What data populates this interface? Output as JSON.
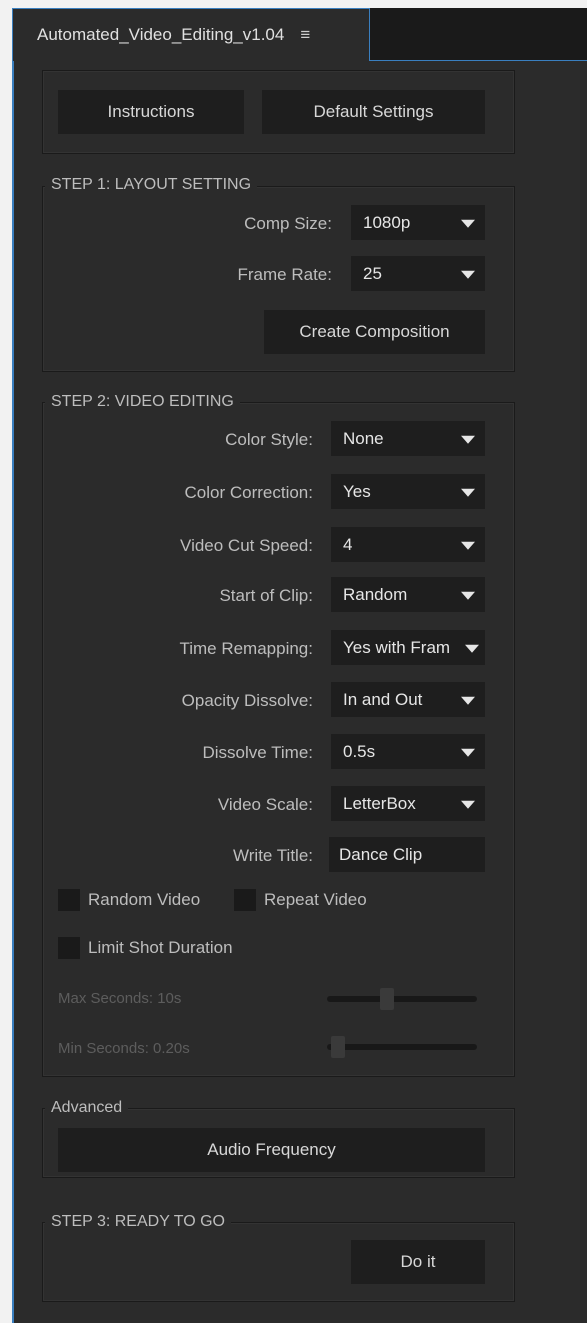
{
  "panel": {
    "title": "Automated_Video_Editing_v1.04",
    "menu_icon": "≡"
  },
  "top_buttons": {
    "instructions": "Instructions",
    "default_settings": "Default Settings"
  },
  "step1": {
    "label": "STEP 1: LAYOUT SETTING",
    "comp_size_label": "Comp Size:",
    "comp_size_value": "1080p",
    "frame_rate_label": "Frame Rate:",
    "frame_rate_value": "25",
    "create_button": "Create Composition"
  },
  "step2": {
    "label": "STEP 2: VIDEO EDITING",
    "rows": [
      {
        "label": "Color Style:",
        "value": "None"
      },
      {
        "label": "Color Correction:",
        "value": "Yes"
      },
      {
        "label": "Video Cut Speed:",
        "value": "4"
      },
      {
        "label": "Start of Clip:",
        "value": "Random"
      },
      {
        "label": "Time Remapping:",
        "value": "Yes with Fram"
      },
      {
        "label": "Opacity Dissolve:",
        "value": "In and Out"
      },
      {
        "label": "Dissolve Time:",
        "value": "0.5s"
      },
      {
        "label": "Video Scale:",
        "value": "LetterBox"
      }
    ],
    "write_title_label": "Write Title:",
    "write_title_value": "Dance Clip",
    "random_video": "Random Video",
    "repeat_video": "Repeat Video",
    "limit_shot": "Limit Shot Duration",
    "max_seconds": "Max Seconds: 10s",
    "min_seconds": "Min Seconds: 0.20s",
    "max_slider_fraction": 0.4,
    "min_slider_fraction": 0.07
  },
  "advanced": {
    "label": "Advanced",
    "audio_button": "Audio Frequency"
  },
  "step3": {
    "label": "STEP 3: READY TO GO",
    "do_it": "Do it"
  },
  "colors": {
    "accent": "#3a7fbf",
    "panel_bg": "#2b2b2b",
    "control_bg": "#1e1e1e"
  }
}
